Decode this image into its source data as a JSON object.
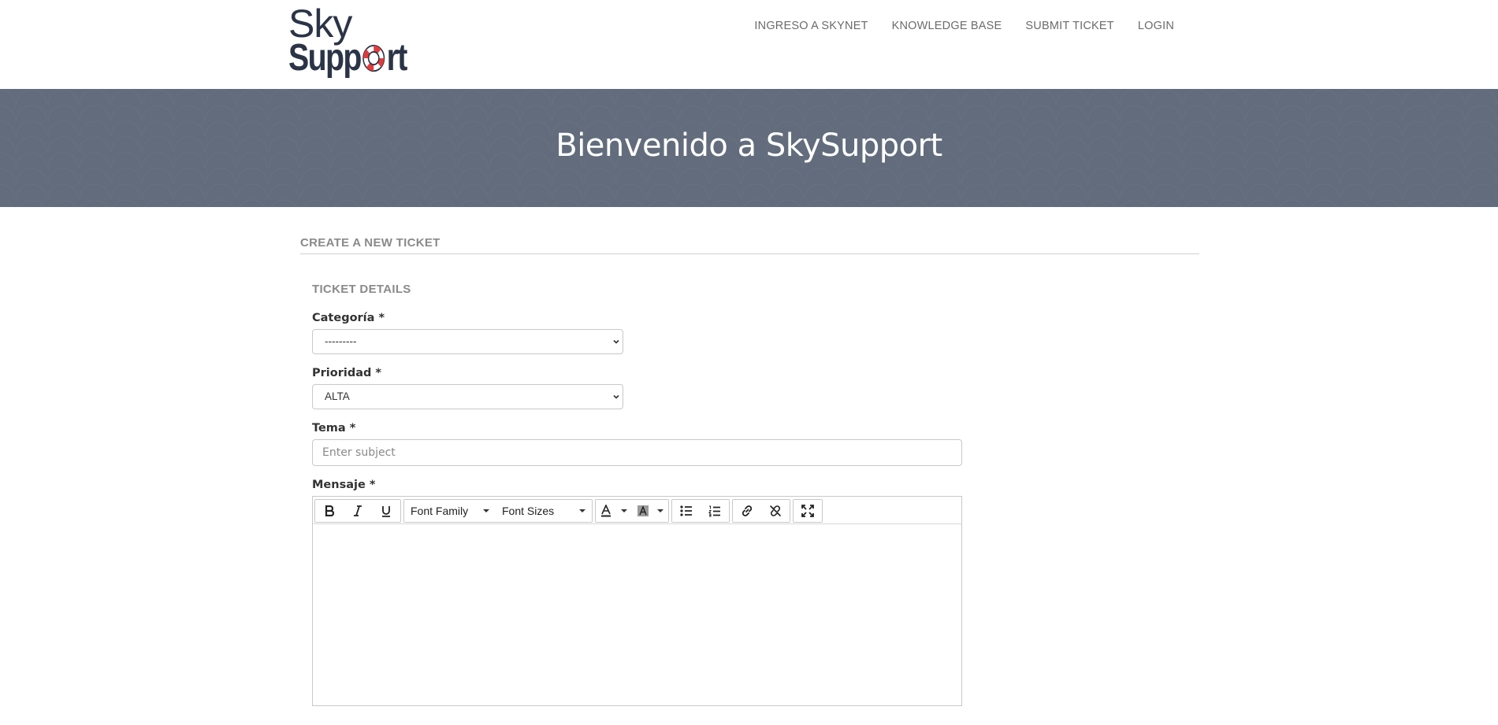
{
  "brand": {
    "line1": "Sky",
    "line2_prefix": "Supp",
    "line2_suffix": "rt"
  },
  "nav": [
    "INGRESO A SKYNET",
    "KNOWLEDGE BASE",
    "SUBMIT TICKET",
    "LOGIN"
  ],
  "banner": {
    "title": "Bienvenido a SkySupport"
  },
  "page": {
    "section_title": "CREATE A NEW TICKET",
    "panel_title": "TICKET DETAILS"
  },
  "form": {
    "categoria": {
      "label": "Categoría *",
      "value": "---------"
    },
    "prioridad": {
      "label": "Prioridad *",
      "value": "ALTA"
    },
    "tema": {
      "label": "Tema *",
      "placeholder": "Enter subject"
    },
    "mensaje": {
      "label": "Mensaje *"
    }
  },
  "toolbar": {
    "font_family": "Font Family",
    "font_sizes": "Font Sizes"
  },
  "colors": {
    "banner": "#626c7c",
    "brand": "#2b3447",
    "lifebuoy_red": "#e23b3b"
  }
}
